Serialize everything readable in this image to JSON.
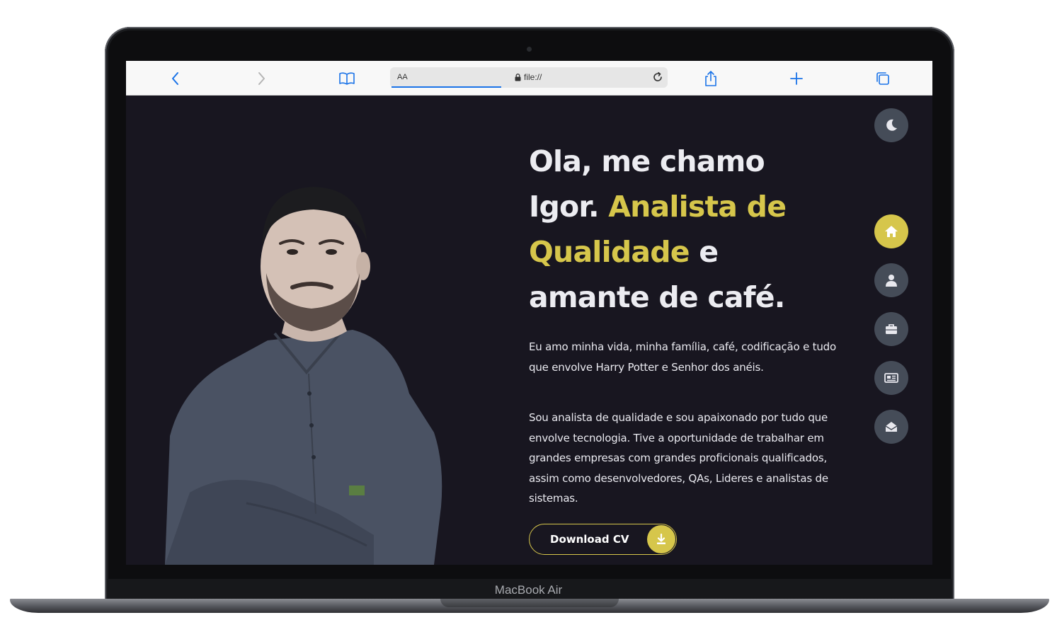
{
  "device": {
    "label": "MacBook Air"
  },
  "browser": {
    "reader_label": "AA",
    "url": "file://"
  },
  "hero": {
    "title_part1": "Ola, me chamo Igor. ",
    "title_accent": "Analista de Qualidade",
    "title_part2": " e amante de café.",
    "paragraph1": "Eu amo minha vida, minha família, café, codificação e tudo que envolve Harry Potter e Senhor dos anéis.",
    "paragraph2": "Sou analista de qualidade e sou apaixonado por tudo que envolve tecnologia. Tive a oportunidade de trabalhar em grandes empresas com grandes proficionais qualificados, assim como desenvolvedores, QAs, Lideres e analistas de sistemas.",
    "cta_label": "Download CV"
  },
  "side_nav": {
    "theme_toggle_icon": "moon-icon",
    "items": [
      {
        "icon": "home-icon",
        "active": true
      },
      {
        "icon": "user-icon",
        "active": false
      },
      {
        "icon": "briefcase-icon",
        "active": false
      },
      {
        "icon": "newspaper-icon",
        "active": false
      },
      {
        "icon": "envelope-open-icon",
        "active": false
      }
    ]
  },
  "colors": {
    "background": "#181620",
    "accent": "#d6c64b",
    "nav_button": "#454c58",
    "text": "#ececf1"
  }
}
